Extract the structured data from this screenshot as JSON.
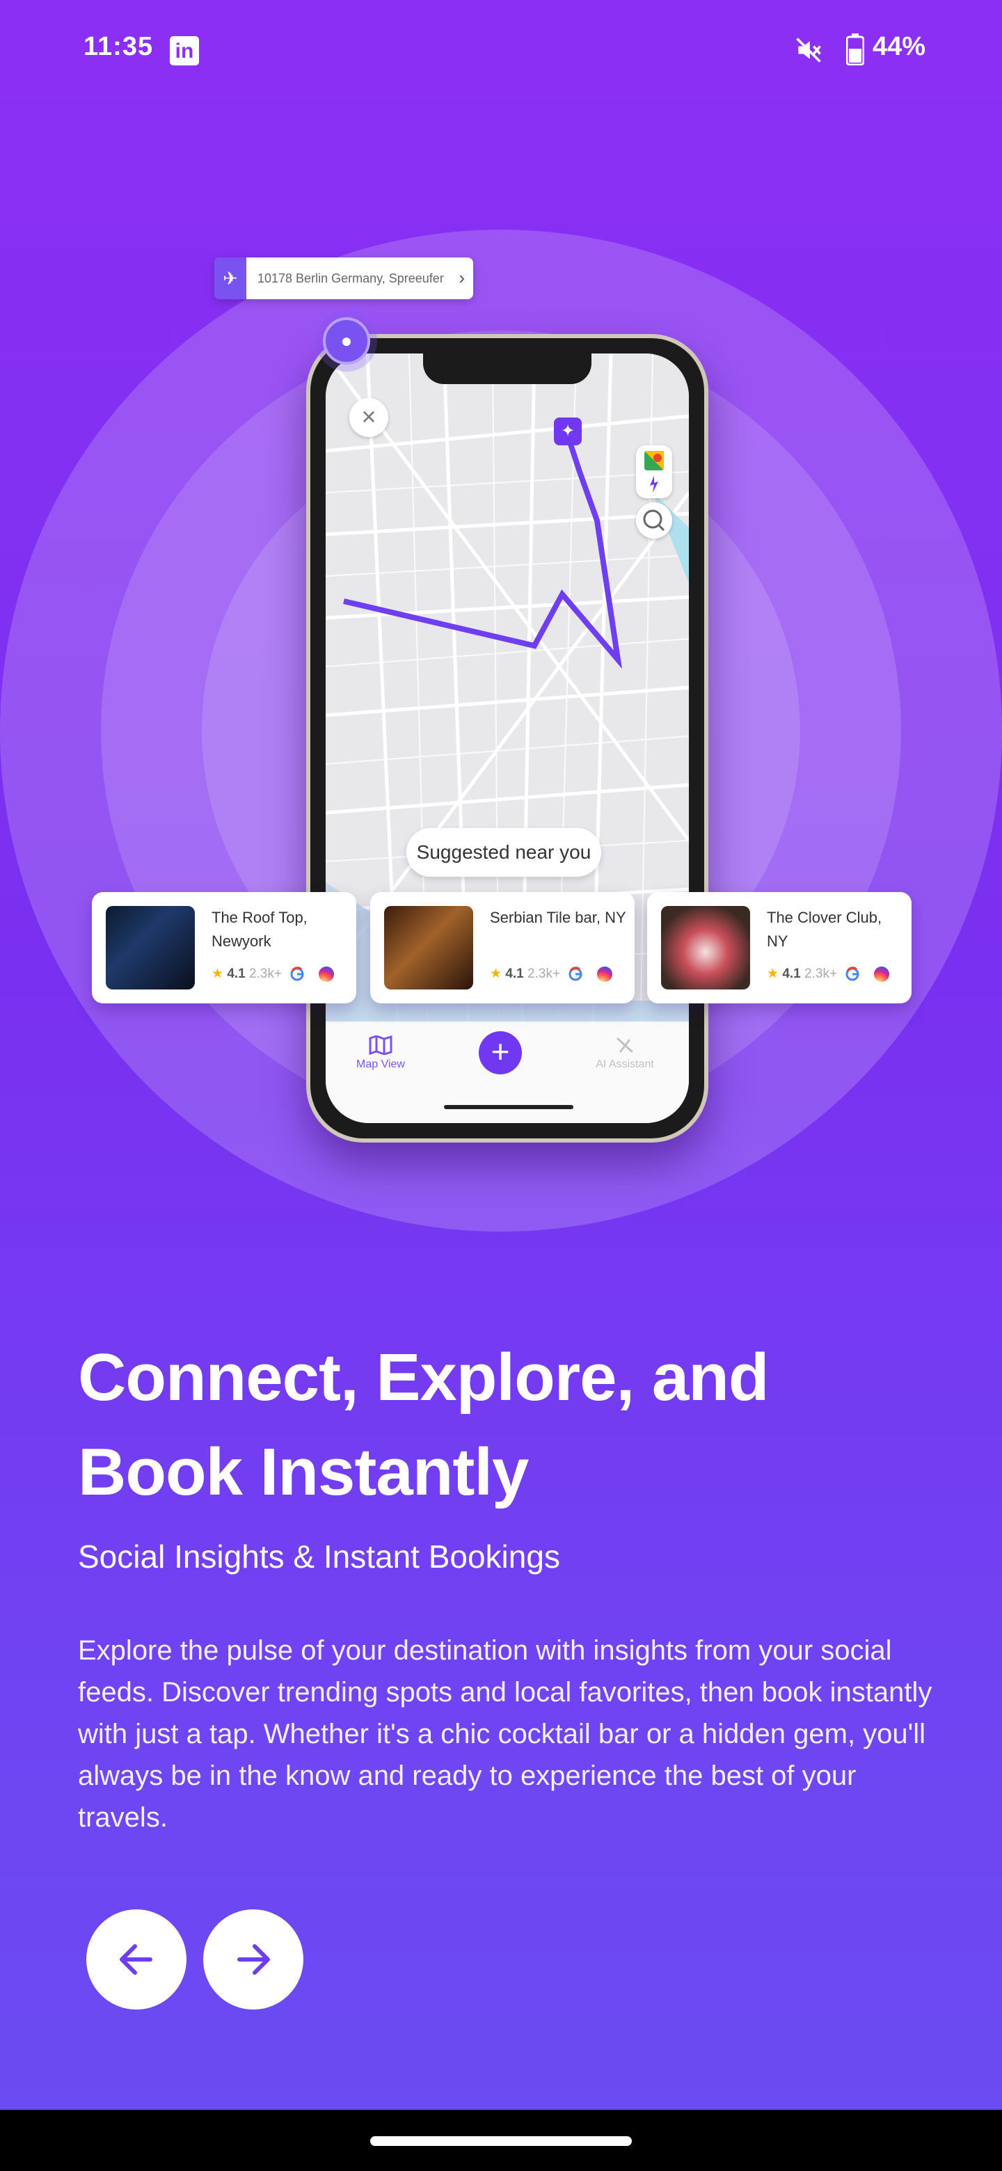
{
  "status_bar": {
    "time": "11:35",
    "battery": "44%",
    "icons": [
      "linkedin-icon",
      "mute-icon",
      "battery-icon"
    ]
  },
  "illustration": {
    "address_pill": "10178 Berlin Germany, Spreeufer",
    "suggested_label": "Suggested near you",
    "bottom_nav": {
      "map_view": "Map View",
      "ai_assistant": "AI Assistant"
    },
    "cards": [
      {
        "title": "The Roof Top, Newyork",
        "rating": "4.1",
        "reviews": "2.3k+"
      },
      {
        "title": "Serbian Tile bar, NY",
        "rating": "4.1",
        "reviews": "2.3k+"
      },
      {
        "title": "The Clover Club, NY",
        "rating": "4.1",
        "reviews": "2.3k+"
      }
    ]
  },
  "content": {
    "headline": "Connect, Explore, and Book Instantly",
    "subtitle": "Social Insights & Instant Bookings",
    "body": "Explore the pulse of your destination with insights from your social feeds. Discover trending spots and local favorites, then book instantly with just a tap. Whether it's a chic cocktail bar or a hidden gem, you'll always be in the know and ready to experience the best of your travels."
  },
  "navigation": {
    "back_icon": "arrow-left-icon",
    "next_icon": "arrow-right-icon"
  },
  "colors": {
    "background_top": "#8b2ff3",
    "background_bottom": "#6a4cf2",
    "accent": "#7038f0",
    "text": "#ffffff"
  }
}
